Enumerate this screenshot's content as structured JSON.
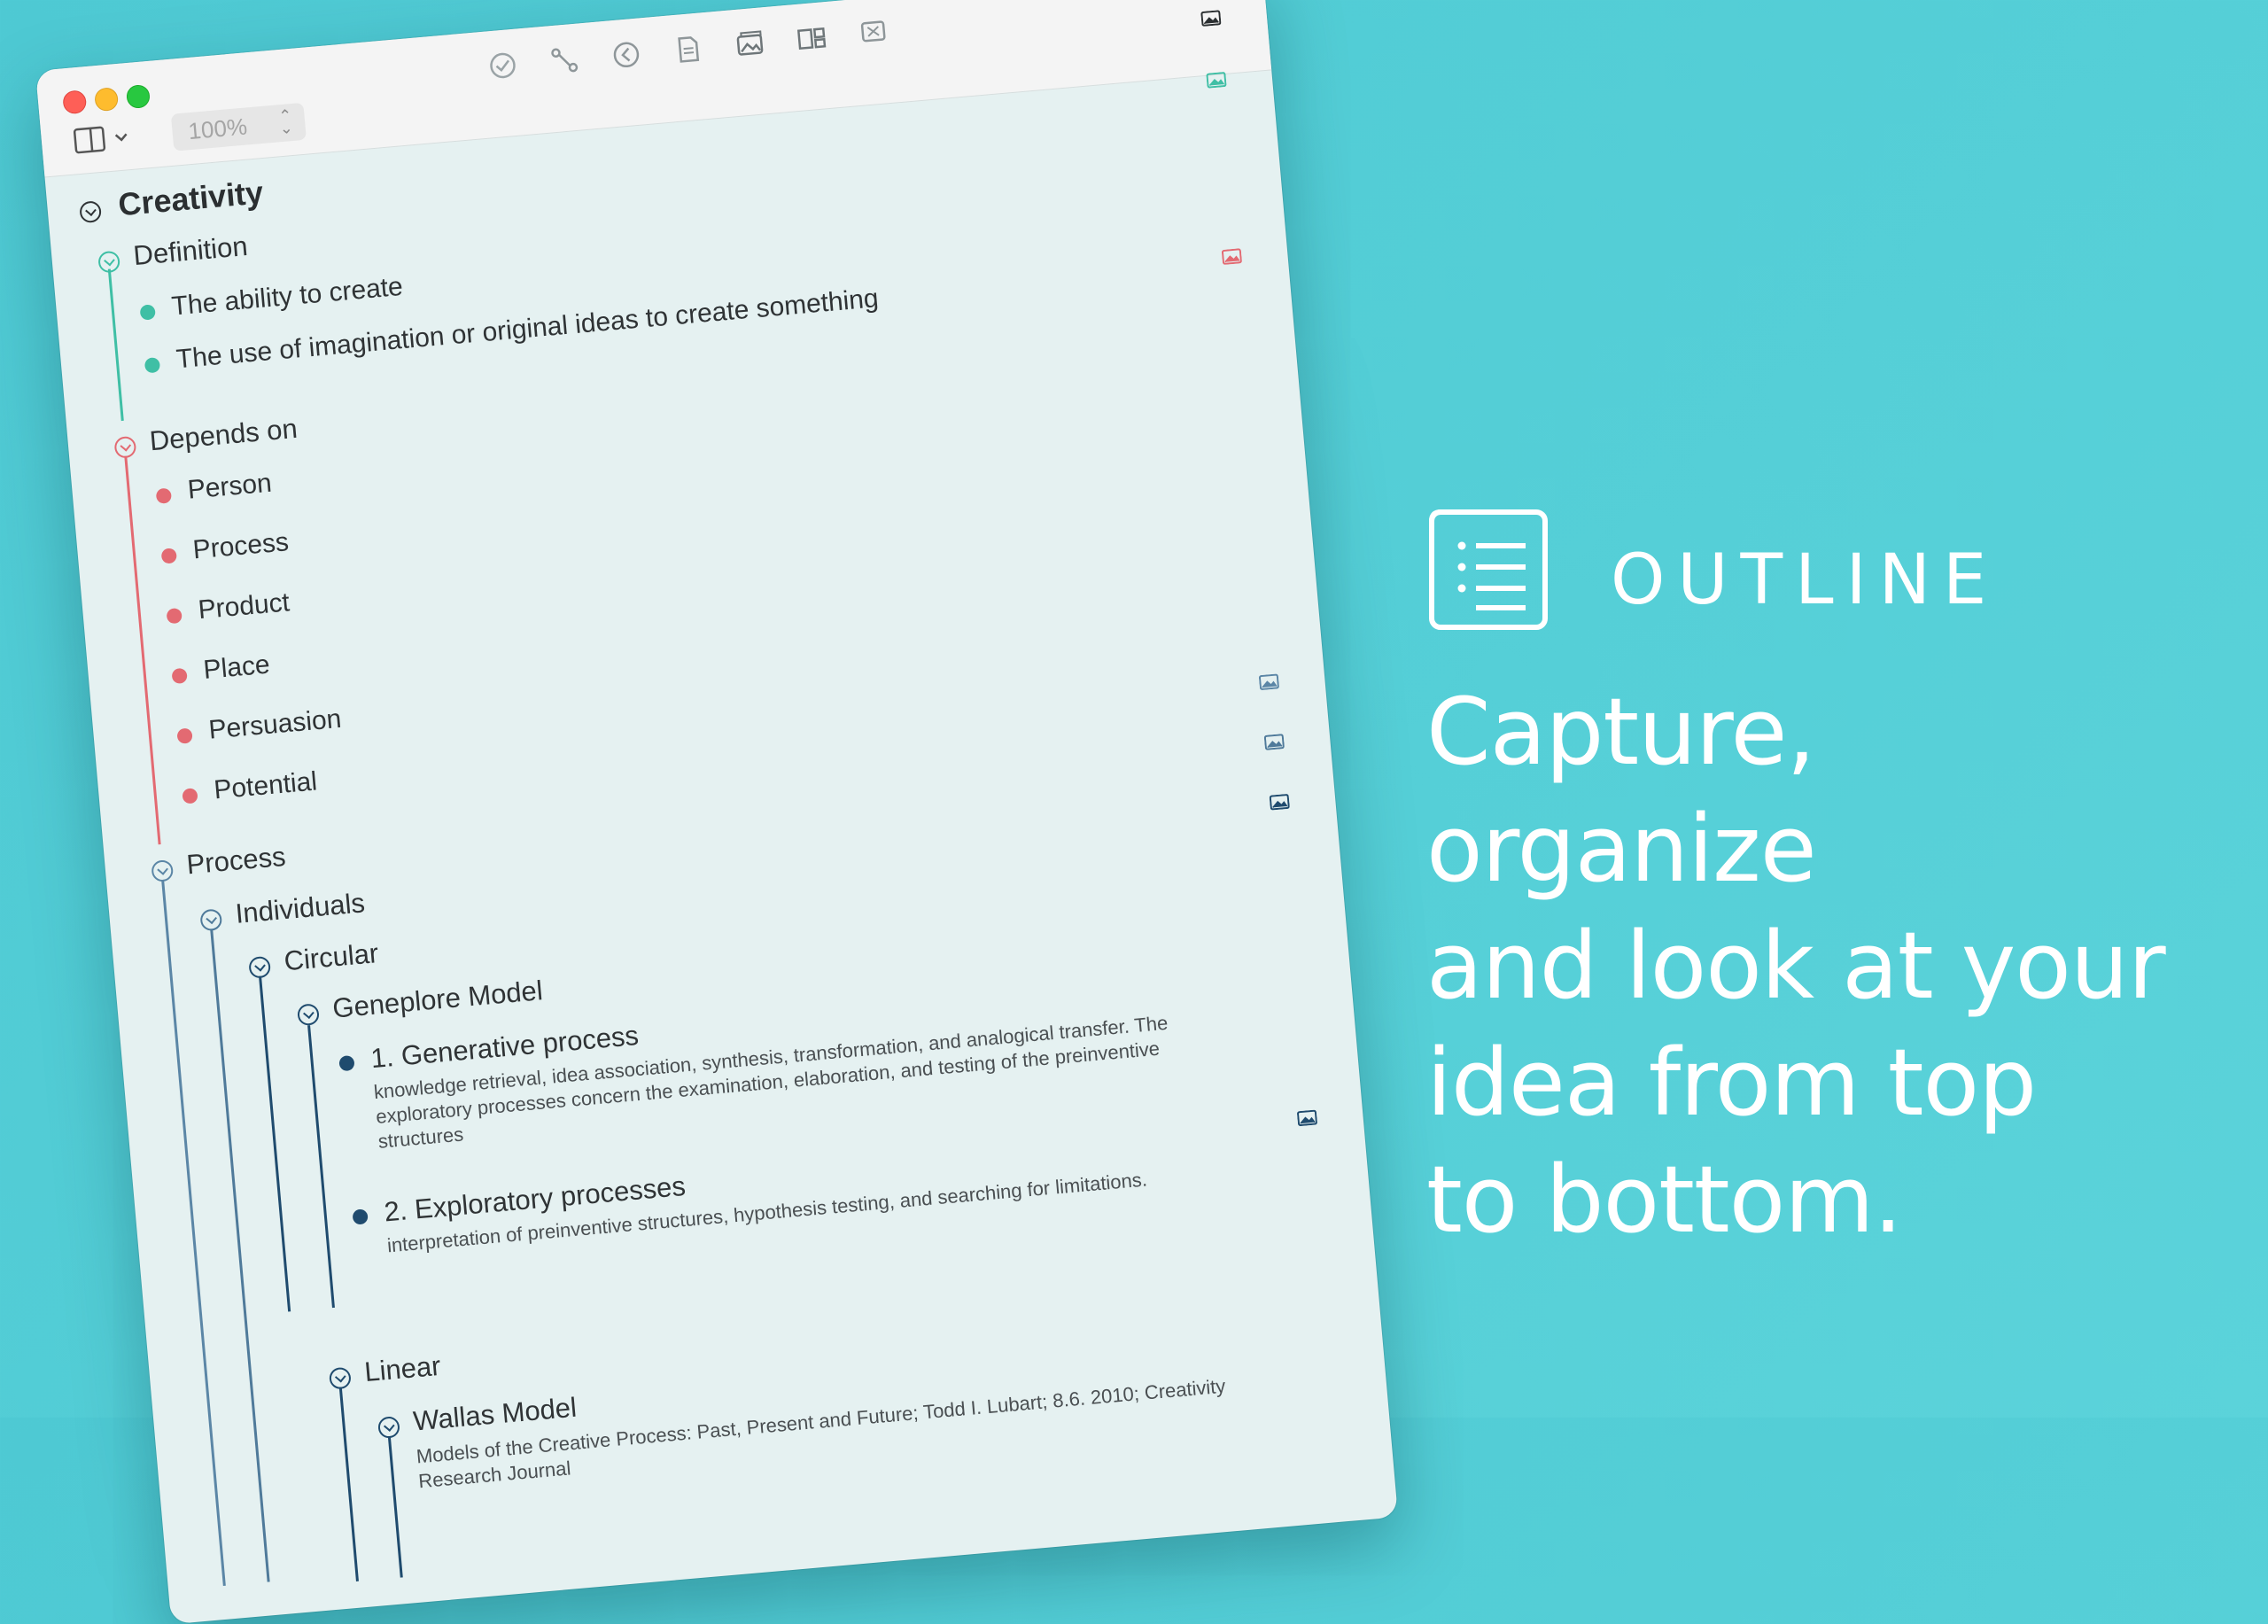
{
  "toolbar": {
    "zoom_value": "100%",
    "icons": [
      "checkmark-icon",
      "branch-icon",
      "back-icon",
      "document-icon",
      "gallery-icon",
      "layout-icon",
      "close-box-icon"
    ]
  },
  "outline": {
    "root": "Creativity",
    "definition": {
      "label": "Definition",
      "items": [
        "The ability to create",
        "The use of imagination or original ideas to create something"
      ]
    },
    "depends_on": {
      "label": "Depends on",
      "items": [
        "Person",
        "Process",
        "Product",
        "Place",
        "Persuasion",
        "Potential"
      ]
    },
    "process": {
      "label": "Process",
      "individuals": "Individuals",
      "circular": "Circular",
      "geneplore": "Geneplore Model",
      "generative_title": "1. Generative process",
      "generative_note": "knowledge retrieval, idea association, synthesis, transformation, and analogical transfer. The exploratory processes concern the examination, elaboration, and testing of the preinventive structures",
      "exploratory_title": "2. Exploratory processes",
      "exploratory_note": "interpretation of preinventive structures, hypothesis testing, and searching for limitations.",
      "linear": "Linear",
      "wallas": "Wallas Model",
      "wallas_note": "Models of the Creative Process: Past, Present and Future; Todd I. Lubart; 8.6. 2010; Creativity Research Journal"
    }
  },
  "colors": {
    "background": "#55cfd7",
    "green": "#3fbfa5",
    "red": "#e36a72",
    "blue": "#5b86a6",
    "navy": "#1f4b6e"
  },
  "marketing": {
    "section_label": "OUTLINE",
    "headline": [
      "Capture, organize",
      "and look at your",
      "idea from top",
      "to bottom."
    ]
  }
}
